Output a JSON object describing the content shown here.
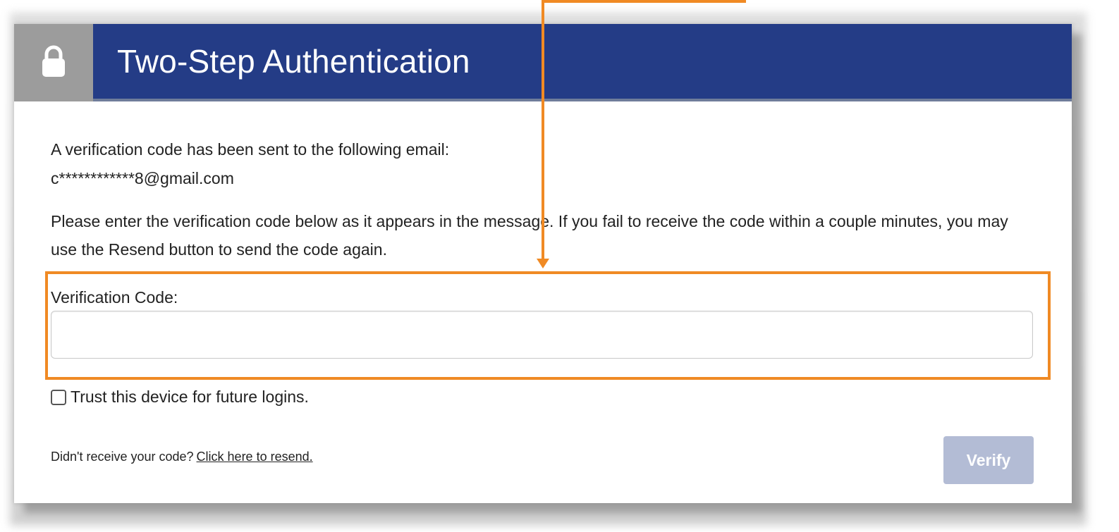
{
  "header": {
    "title": "Two-Step Authentication",
    "lock_icon": "lock-icon",
    "lock_bg_color": "#9c9c9c",
    "title_bg_color": "#243c86"
  },
  "body": {
    "sent_message": "A verification code has been sent to the following email:",
    "masked_email": "c************8@gmail.com",
    "instructions": "Please enter the verification code below as it appears in the message. If you fail to receive the code within a couple minutes, you may use the Resend button to send the code again."
  },
  "form": {
    "code_label": "Verification Code:",
    "code_value": "",
    "trust_label": "Trust this device for future logins.",
    "trust_checked": false
  },
  "footer": {
    "resend_prompt": "Didn't receive your code?",
    "resend_link": "Click here to resend.",
    "verify_label": "Verify",
    "verify_disabled": true
  },
  "annotation": {
    "color": "#f08a24"
  }
}
